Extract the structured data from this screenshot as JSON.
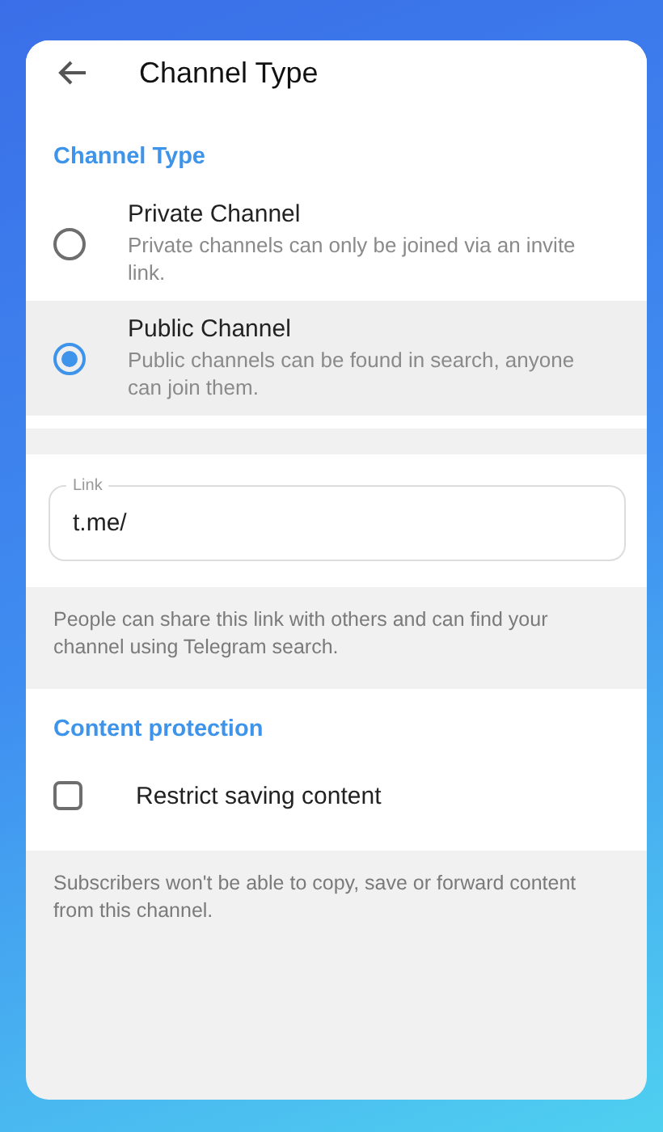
{
  "header": {
    "title": "Channel Type"
  },
  "channel_type": {
    "heading": "Channel Type",
    "options": [
      {
        "title": "Private Channel",
        "description": "Private channels can only be joined via an invite link.",
        "selected": false
      },
      {
        "title": "Public Channel",
        "description": "Public channels can be found in search, anyone can join them.",
        "selected": true
      }
    ]
  },
  "link": {
    "label": "Link",
    "value": "t.me/",
    "hint": "People can share this link with others and can find your channel using Telegram search."
  },
  "content_protection": {
    "heading": "Content protection",
    "option": {
      "label": "Restrict saving content",
      "checked": false
    },
    "hint": "Subscribers won't be able to copy, save or forward content from this channel."
  }
}
